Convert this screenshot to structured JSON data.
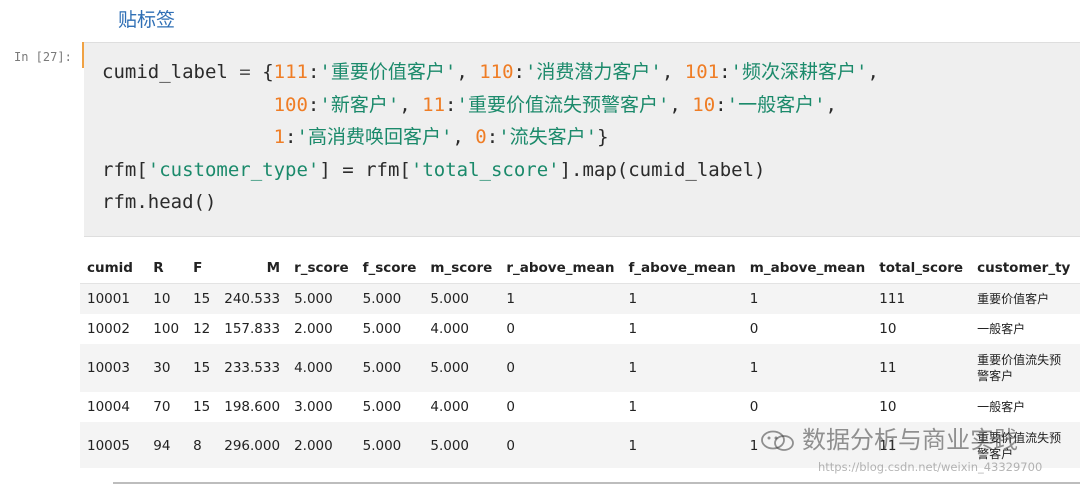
{
  "heading": "贴标签",
  "cell": {
    "prompt": "In [27]:",
    "code": {
      "var_name": "cumid_label",
      "eq": "=",
      "entries": [
        {
          "key": "111",
          "value": "'重要价值客户'"
        },
        {
          "key": "110",
          "value": "'消费潜力客户'"
        },
        {
          "key": "101",
          "value": "'频次深耕客户'"
        },
        {
          "key": "100",
          "value": "'新客户'"
        },
        {
          "key": "11",
          "value": "'重要价值流失预警客户'"
        },
        {
          "key": "10",
          "value": "'一般客户'"
        },
        {
          "key": "1",
          "value": "'高消费唤回客户'"
        },
        {
          "key": "0",
          "value": "'流失客户'"
        }
      ],
      "line4_prefix": "rfm[",
      "line4_col1": "'customer_type'",
      "line4_mid": "] = rfm[",
      "line4_col2": "'total_score'",
      "line4_suffix": "].map(cumid_label)",
      "line5": "rfm.head()"
    }
  },
  "table": {
    "columns": [
      "cumid",
      "R",
      "F",
      "M",
      "r_score",
      "f_score",
      "m_score",
      "r_above_mean",
      "f_above_mean",
      "m_above_mean",
      "total_score",
      "customer_ty"
    ],
    "rows": [
      [
        "10001",
        "10",
        "15",
        "240.533",
        "5.000",
        "5.000",
        "5.000",
        "1",
        "1",
        "1",
        "111",
        "重要价值客户"
      ],
      [
        "10002",
        "100",
        "12",
        "157.833",
        "2.000",
        "5.000",
        "4.000",
        "0",
        "1",
        "0",
        "10",
        "一般客户"
      ],
      [
        "10003",
        "30",
        "15",
        "233.533",
        "4.000",
        "5.000",
        "5.000",
        "0",
        "1",
        "1",
        "11",
        "重要价值流失预警客户"
      ],
      [
        "10004",
        "70",
        "15",
        "198.600",
        "3.000",
        "5.000",
        "4.000",
        "0",
        "1",
        "0",
        "10",
        "一般客户"
      ],
      [
        "10005",
        "94",
        "8",
        "296.000",
        "2.000",
        "5.000",
        "5.000",
        "0",
        "1",
        "1",
        "11",
        "重要价值流失预警客户"
      ]
    ]
  },
  "watermark": {
    "text": "数据分析与商业实践",
    "url": "https://blog.csdn.net/weixin_43329700",
    "icon": "wechat-icon"
  }
}
